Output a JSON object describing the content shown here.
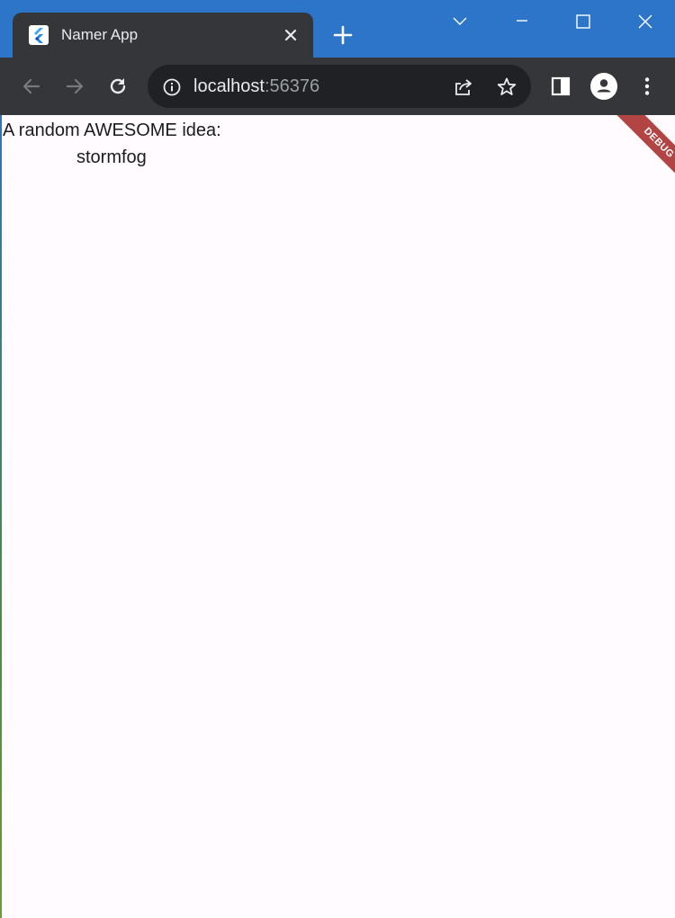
{
  "browser": {
    "tab": {
      "title": "Namer App",
      "favicon": "flutter-icon"
    },
    "new_tab_icon": "plus-icon",
    "window_controls": [
      "chevron-down-icon",
      "minimize-icon",
      "maximize-icon",
      "close-icon"
    ],
    "toolbar": {
      "back_icon": "arrow-left-icon",
      "forward_icon": "arrow-right-icon",
      "reload_icon": "reload-icon",
      "info_icon": "info-icon",
      "url_host": "localhost",
      "url_port": ":56376",
      "share_icon": "share-icon",
      "bookmark_icon": "star-icon",
      "side_panel_icon": "side-panel-icon",
      "profile_icon": "profile-icon",
      "menu_icon": "kebab-menu-icon"
    },
    "colors": {
      "tabstrip": "#2c75c8",
      "toolbar": "#35363a",
      "omnibox": "#202124",
      "page_background": "#fffbfe"
    }
  },
  "app": {
    "headline": "A random AWESOME idea:",
    "word_pair": "stormfog",
    "debug_banner": "DEBUG",
    "debug_banner_color": "#a42323"
  }
}
